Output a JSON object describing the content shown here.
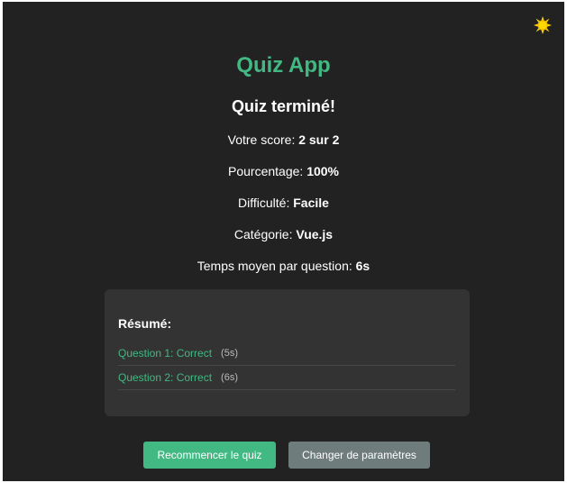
{
  "app": {
    "title": "Quiz App",
    "theme_icon": "sun-icon"
  },
  "result": {
    "heading": "Quiz terminé!",
    "score_label": "Votre score:",
    "score_value": "2 sur 2",
    "percent_label": "Pourcentage:",
    "percent_value": "100%",
    "difficulty_label": "Difficulté:",
    "difficulty_value": "Facile",
    "category_label": "Catégorie:",
    "category_value": "Vue.js",
    "avg_time_label": "Temps moyen par question:",
    "avg_time_value": "6s"
  },
  "summary": {
    "title": "Résumé:",
    "rows": [
      {
        "label": "Question 1: Correct",
        "time": "(5s)"
      },
      {
        "label": "Question 2: Correct",
        "time": "(6s)"
      }
    ]
  },
  "buttons": {
    "restart": "Recommencer le quiz",
    "settings": "Changer de paramètres"
  },
  "colors": {
    "background": "#222222",
    "accent": "#42b883",
    "card": "#333333",
    "secondary_button": "#6f7c7c",
    "sun": "#ffd700"
  }
}
